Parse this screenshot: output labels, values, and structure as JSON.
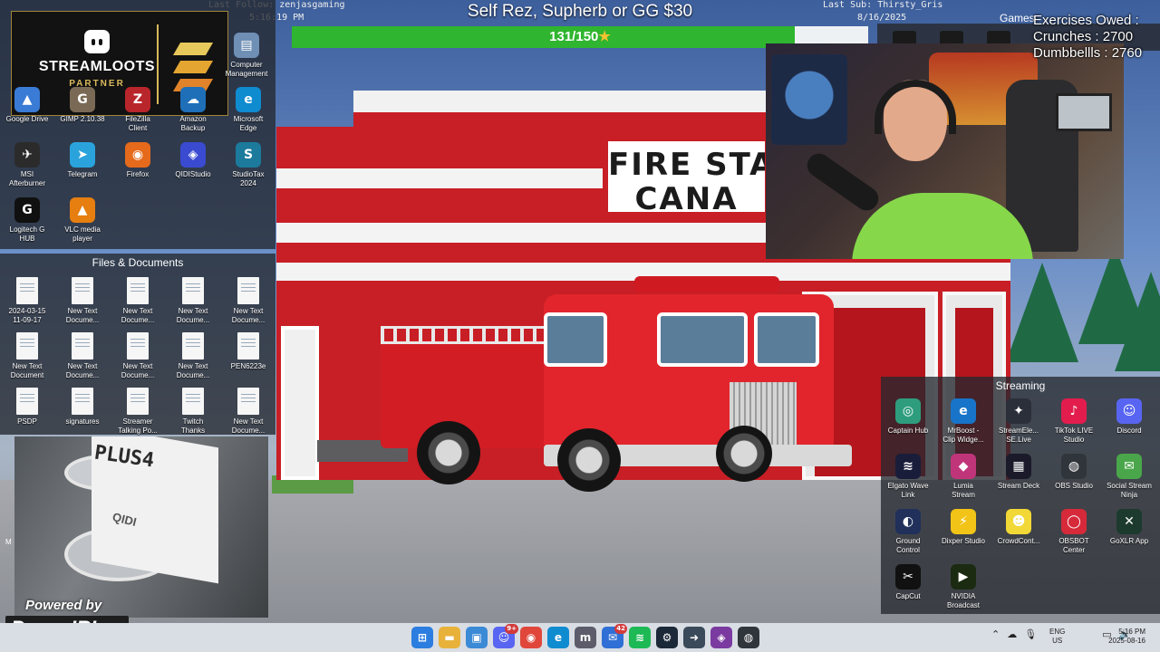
{
  "ribbon": {
    "last_follow": "Last Follow: zenjasgaming",
    "time": "5:16:19 PM",
    "last_sub": "Last Sub: Thirsty_Gris",
    "date": "8/16/2025"
  },
  "goal": {
    "title": "Self Rez, Supherb or GG $30",
    "progress_text": "131/150",
    "current": 131,
    "target": 150,
    "star": "★"
  },
  "streamloots": {
    "name": "STREAMLOOTS",
    "tier": "PARTNER"
  },
  "games": {
    "title": "Games"
  },
  "exercises": {
    "title": "Exercises Owed :",
    "crunches": "Crunches : 2700",
    "dumbbells": "Dumbbellls : 2760"
  },
  "desktop_icons": [
    {
      "label": "Google Drive",
      "icon": "google-drive-icon",
      "color": "#3a7bd5",
      "glyph": "▲"
    },
    {
      "label": "GIMP 2.10.38",
      "icon": "gimp-icon",
      "color": "#7a6a55",
      "glyph": "G"
    },
    {
      "label": "FileZilla\nClient",
      "icon": "filezilla-icon",
      "color": "#b8262b",
      "glyph": "Z"
    },
    {
      "label": "Amazon\nBackup",
      "icon": "amazon-backup-icon",
      "color": "#1f6fb8",
      "glyph": "☁"
    },
    {
      "label": "Microsoft\nEdge",
      "icon": "edge-icon",
      "color": "#0f8bd0",
      "glyph": "e"
    },
    {
      "label": "MSI\nAfterburner",
      "icon": "msi-afterburner-icon",
      "color": "#2b2b2b",
      "glyph": "✈"
    },
    {
      "label": "Telegram",
      "icon": "telegram-icon",
      "color": "#2aa3dd",
      "glyph": "➤"
    },
    {
      "label": "Firefox",
      "icon": "firefox-icon",
      "color": "#e56a1c",
      "glyph": "◉"
    },
    {
      "label": "QIDIStudio",
      "icon": "qidistudio-icon",
      "color": "#3a4bd1",
      "glyph": "◈"
    },
    {
      "label": "StudioTax\n2024",
      "icon": "studiotax-icon",
      "color": "#1c7a9c",
      "glyph": "S"
    },
    {
      "label": "Logitech G\nHUB",
      "icon": "logitech-ghub-icon",
      "color": "#101010",
      "glyph": "G"
    },
    {
      "label": "VLC media\nplayer",
      "icon": "vlc-icon",
      "color": "#e67e10",
      "glyph": "▲"
    }
  ],
  "computer_management": {
    "label": "Computer\nManagement"
  },
  "files_panel": {
    "title": "Files & Documents",
    "items": [
      {
        "label": "2024-03-15\n11-09-17"
      },
      {
        "label": "New Text\nDocume..."
      },
      {
        "label": "New Text\nDocume..."
      },
      {
        "label": "New Text\nDocume..."
      },
      {
        "label": "New Text\nDocume..."
      },
      {
        "label": "New Text\nDocument"
      },
      {
        "label": "New Text\nDocume..."
      },
      {
        "label": "New Text\nDocume..."
      },
      {
        "label": "New Text\nDocume..."
      },
      {
        "label": "PEN6223e"
      },
      {
        "label": "PSDP"
      },
      {
        "label": "signatures"
      },
      {
        "label": "Streamer\nTalking Po..."
      },
      {
        "label": "Twitch\nThanks"
      },
      {
        "label": "New Text\nDocume..."
      }
    ]
  },
  "scene": {
    "sign_line1": "FIRE STA",
    "sign_line2": "CANA"
  },
  "printer_cam": {
    "brand": "PLUS4",
    "model": "QIDI",
    "side_text": "M"
  },
  "powered": {
    "label": "Powered by",
    "brand": "PowerIRL"
  },
  "streaming_panel": {
    "title": "Streaming",
    "items": [
      {
        "label": "Captain Hub",
        "icon": "captain-hub-icon",
        "color": "#2e9d7d",
        "glyph": "◎"
      },
      {
        "label": "MrBoost -\nClip Widge...",
        "icon": "mrboost-icon",
        "color": "#1874c8",
        "glyph": "e"
      },
      {
        "label": "StreamEle...\nSE.Live",
        "icon": "streamelements-icon",
        "color": "#2b2f3a",
        "glyph": "✦"
      },
      {
        "label": "TikTok LIVE\nStudio",
        "icon": "tiktok-live-icon",
        "color": "#e21d4d",
        "glyph": "♪"
      },
      {
        "label": "Discord",
        "icon": "discord-icon",
        "color": "#5865f2",
        "glyph": "☺"
      },
      {
        "label": "Elgato Wave\nLink",
        "icon": "elgato-wave-icon",
        "color": "#1a1d3a",
        "glyph": "≋"
      },
      {
        "label": "Lumia\nStream",
        "icon": "lumia-stream-icon",
        "color": "#c0357a",
        "glyph": "◆"
      },
      {
        "label": "Stream Deck",
        "icon": "stream-deck-icon",
        "color": "#1a1a2a",
        "glyph": "▦"
      },
      {
        "label": "OBS Studio",
        "icon": "obs-studio-icon",
        "color": "#30343b",
        "glyph": "◍"
      },
      {
        "label": "Social Stream\nNinja",
        "icon": "social-stream-ninja-icon",
        "color": "#4aa64a",
        "glyph": "✉"
      },
      {
        "label": "Ground\nControl",
        "icon": "ground-control-icon",
        "color": "#20305a",
        "glyph": "◐"
      },
      {
        "label": "Dixper Studio",
        "icon": "dixper-studio-icon",
        "color": "#f2c417",
        "glyph": "⚡"
      },
      {
        "label": "CrowdCont...",
        "icon": "crowd-control-icon",
        "color": "#f2d836",
        "glyph": "☻"
      },
      {
        "label": "OBSBOT\nCenter",
        "icon": "obsbot-center-icon",
        "color": "#d62a3a",
        "glyph": "◯"
      },
      {
        "label": "GoXLR App",
        "icon": "goxlr-icon",
        "color": "#1d3a2e",
        "glyph": "✕"
      },
      {
        "label": "CapCut",
        "icon": "capcut-icon",
        "color": "#111111",
        "glyph": "✂"
      },
      {
        "label": "NVIDIA\nBroadcast",
        "icon": "nvidia-broadcast-icon",
        "color": "#1b2b12",
        "glyph": "▶"
      }
    ]
  },
  "taskbar": {
    "apps": [
      {
        "icon": "windows-start-icon",
        "color": "#2b7de0",
        "glyph": "⊞",
        "badge": ""
      },
      {
        "icon": "file-explorer-icon",
        "color": "#e8b23a",
        "glyph": "▬",
        "badge": ""
      },
      {
        "icon": "microsoft-store-icon",
        "color": "#3b8ad6",
        "glyph": "▣",
        "badge": ""
      },
      {
        "icon": "discord-taskbar-icon",
        "color": "#5865f2",
        "glyph": "☺",
        "badge": "9+"
      },
      {
        "icon": "chrome-icon",
        "color": "#e0473a",
        "glyph": "◉",
        "badge": ""
      },
      {
        "icon": "edge-taskbar-icon",
        "color": "#0f8bd0",
        "glyph": "e",
        "badge": ""
      },
      {
        "icon": "mobiglas-icon",
        "color": "#5c5c6a",
        "glyph": "m",
        "badge": ""
      },
      {
        "icon": "mail-icon",
        "color": "#2f6fd6",
        "glyph": "✉",
        "badge": "42"
      },
      {
        "icon": "spotify-icon",
        "color": "#1db954",
        "glyph": "≋",
        "badge": ""
      },
      {
        "icon": "steam-icon",
        "color": "#1b2838",
        "glyph": "⚙",
        "badge": ""
      },
      {
        "icon": "remote-desktop-icon",
        "color": "#3a4a5a",
        "glyph": "➜",
        "badge": ""
      },
      {
        "icon": "game-overlay-icon",
        "color": "#7a3aa0",
        "glyph": "◈",
        "badge": ""
      },
      {
        "icon": "obs-taskbar-icon",
        "color": "#30343b",
        "glyph": "◍",
        "badge": ""
      }
    ],
    "lang_line1": "ENG",
    "lang_line2": "US",
    "clock_time": "5:16 PM",
    "clock_date": "2025-08-16"
  }
}
